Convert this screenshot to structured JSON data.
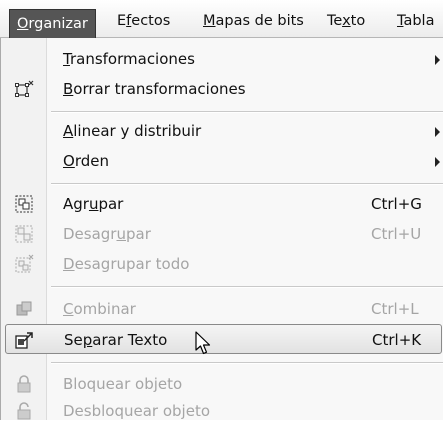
{
  "menubar": {
    "items": [
      {
        "pre": "",
        "u": "O",
        "post": "rganizar"
      },
      {
        "pre": "E",
        "u": "f",
        "post": "ectos"
      },
      {
        "pre": "",
        "u": "M",
        "post": "apas de bits"
      },
      {
        "pre": "Te",
        "u": "x",
        "post": "to"
      },
      {
        "pre": "",
        "u": "T",
        "post": "abla"
      }
    ]
  },
  "menu": {
    "items": [
      {
        "pre": "",
        "u": "T",
        "post": "ransformaciones",
        "shortcut": "",
        "icon": "",
        "submenu": true
      },
      {
        "pre": "",
        "u": "B",
        "post": "orrar transformaciones",
        "shortcut": "",
        "icon": "clear-transform-icon",
        "submenu": false
      },
      {
        "pre": "",
        "u": "A",
        "post": "linear y distribuir",
        "shortcut": "",
        "icon": "",
        "submenu": true
      },
      {
        "pre": "",
        "u": "O",
        "post": "rden",
        "shortcut": "",
        "icon": "",
        "submenu": true
      },
      {
        "pre": "Agr",
        "u": "u",
        "post": "par",
        "shortcut": "Ctrl+G",
        "icon": "group-icon",
        "submenu": false
      },
      {
        "pre": "Desagr",
        "u": "u",
        "post": "par",
        "shortcut": "Ctrl+U",
        "icon": "ungroup-icon",
        "submenu": false
      },
      {
        "pre": "",
        "u": "D",
        "post": "esagrupar todo",
        "shortcut": "",
        "icon": "ungroup-all-icon",
        "submenu": false
      },
      {
        "pre": "",
        "u": "C",
        "post": "ombinar",
        "shortcut": "Ctrl+L",
        "icon": "combine-icon",
        "submenu": false
      },
      {
        "pre": "Se",
        "u": "p",
        "post": "arar Texto",
        "shortcut": "Ctrl+K",
        "icon": "break-apart-icon",
        "submenu": false
      },
      {
        "pre": "",
        "u": "",
        "post": "Bloquear objeto",
        "shortcut": "",
        "icon": "lock-icon",
        "submenu": false
      },
      {
        "pre": "",
        "u": "",
        "post": "Desbloquear objeto",
        "shortcut": "",
        "icon": "unlock-icon",
        "submenu": false
      }
    ]
  }
}
